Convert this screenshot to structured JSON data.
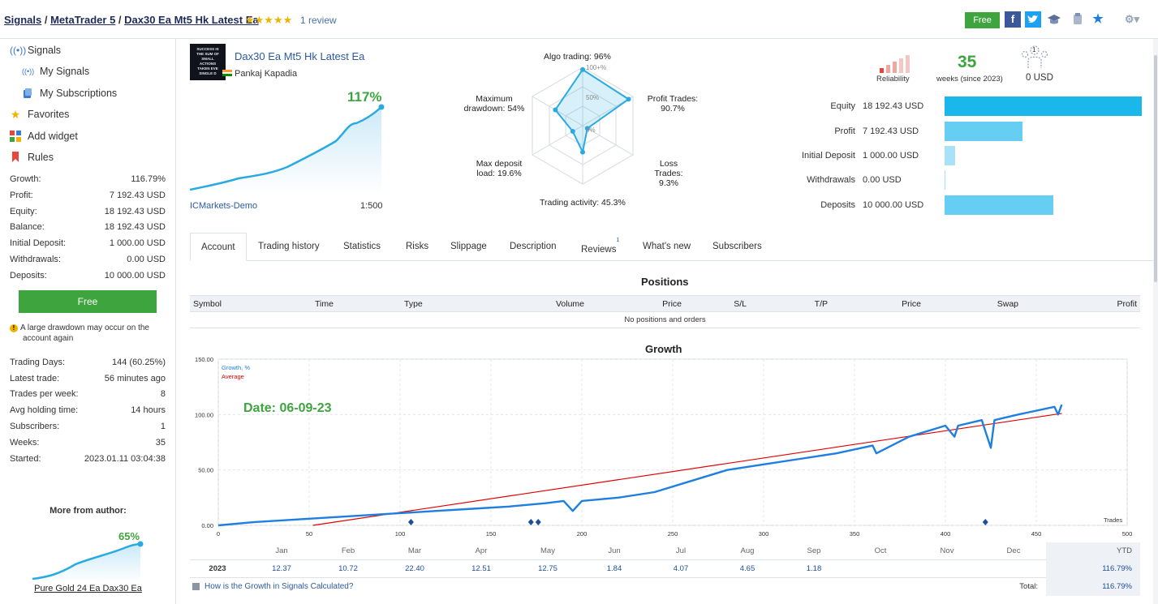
{
  "header": {
    "breadcrumb": [
      "Signals",
      "MetaTrader 5",
      "Dax30 Ea Mt5 Hk Latest Ea"
    ],
    "separator": " / ",
    "stars": "★★★★★",
    "review_text": "1 review",
    "free_button": "Free",
    "icons": [
      "facebook-icon",
      "twitter-icon",
      "graduation-cap-icon",
      "clipboard-icon",
      "star-icon",
      "gear-icon"
    ]
  },
  "sidebar": {
    "nav": [
      {
        "label": "Signals",
        "icon": "antenna-icon"
      },
      {
        "label": "My Signals",
        "icon": "antenna-icon"
      },
      {
        "label": "My Subscriptions",
        "icon": "subscriptions-icon"
      },
      {
        "label": "Favorites",
        "icon": "star-icon"
      },
      {
        "label": "Add widget",
        "icon": "widget-icon"
      },
      {
        "label": "Rules",
        "icon": "bookmark-icon"
      }
    ],
    "stats": [
      {
        "label": "Growth:",
        "value": "116.79%"
      },
      {
        "label": "Profit:",
        "value": "7 192.43 USD"
      },
      {
        "label": "Equity:",
        "value": "18 192.43 USD"
      },
      {
        "label": "Balance:",
        "value": "18 192.43 USD"
      },
      {
        "label": "Initial Deposit:",
        "value": "1 000.00 USD"
      },
      {
        "label": "Withdrawals:",
        "value": "0.00 USD"
      },
      {
        "label": "Deposits:",
        "value": "10 000.00 USD"
      }
    ],
    "free_button": "Free",
    "warning_line1": "A large drawdown may occur on the",
    "warning_line2": "account again",
    "stats2": [
      {
        "label": "Trading Days:",
        "value": "144 (60.25%)"
      },
      {
        "label": "Latest trade:",
        "value": "56 minutes ago"
      },
      {
        "label": "Trades per week:",
        "value": "8"
      },
      {
        "label": "Avg holding time:",
        "value": "14 hours"
      },
      {
        "label": "Subscribers:",
        "value": "1"
      },
      {
        "label": "Weeks:",
        "value": "35"
      },
      {
        "label": "Started:",
        "value": "2023.01.11 03:04:38"
      }
    ],
    "more_from_author": "More from author:",
    "author_growth": "65%",
    "author_signal": "Pure Gold 24 Ea Dax30 Ea"
  },
  "signal": {
    "name": "Dax30 Ea Mt5 Hk Latest Ea",
    "author": "Pankaj Kapadia",
    "growth": "117%",
    "broker": "ICMarkets-Demo",
    "leverage": "1:500",
    "thumb_lines": [
      "SUCCESS IS",
      "THE SUM OF",
      "SMALL",
      "ACTIONS",
      "TAKEN EVE",
      "SINGLE D"
    ]
  },
  "radar": {
    "labels": {
      "algo": "Algo trading: 96%",
      "profit_trades_1": "Profit Trades:",
      "profit_trades_2": "90.7%",
      "loss_trades_1": "Loss Trades:",
      "loss_trades_2": "9.3%",
      "activity": "Trading activity: 45.3%",
      "max_deposit_1": "Max deposit",
      "max_deposit_2": "load: 19.6%",
      "drawdown_1": "Maximum",
      "drawdown_2": "drawdown: 54%",
      "ring100": "100+%",
      "ring50": "50%",
      "ring0": "0%"
    },
    "values": {
      "algo": 96,
      "profit": 90.7,
      "loss": 9.3,
      "activity": 45.3,
      "deposit": 19.6,
      "drawdown": 54
    }
  },
  "summary": {
    "reliability_label": "Reliability",
    "weeks_value": "35",
    "weeks_label": "weeks (since 2023)",
    "subscribers_value": "1",
    "subscribers_funds": "0 USD",
    "bars": [
      {
        "label": "Equity",
        "value": "18 192.43 USD",
        "amount": 18192.43,
        "color": "#1ab7ea"
      },
      {
        "label": "Profit",
        "value": "7 192.43 USD",
        "amount": 7192.43,
        "color": "#66cdf3"
      },
      {
        "label": "Initial Deposit",
        "value": "1 000.00 USD",
        "amount": 1000,
        "color": "#a9e2f7"
      },
      {
        "label": "Withdrawals",
        "value": "0.00 USD",
        "amount": 0,
        "color": "#a9e2f7"
      },
      {
        "label": "Deposits",
        "value": "10 000.00 USD",
        "amount": 10000,
        "color": "#66cdf3"
      }
    ]
  },
  "tabs": [
    {
      "label": "Account",
      "active": true
    },
    {
      "label": "Trading history"
    },
    {
      "label": "Statistics"
    },
    {
      "label": "Risks"
    },
    {
      "label": "Slippage"
    },
    {
      "label": "Description"
    },
    {
      "label": "Reviews",
      "badge": "1"
    },
    {
      "label": "What's new"
    },
    {
      "label": "Subscribers"
    }
  ],
  "positions": {
    "title": "Positions",
    "columns": [
      "Symbol",
      "Time",
      "Type",
      "Volume",
      "Price",
      "S/L",
      "T/P",
      "Price",
      "Swap",
      "Profit"
    ],
    "empty": "No positions and orders"
  },
  "growth": {
    "title": "Growth",
    "legend_growth": "Growth, %",
    "legend_average": "Average",
    "date_overlay": "Date: 06-09-23",
    "trades_label": "Trades",
    "help_link": "How is the Growth in Signals Calculated?",
    "months": [
      "Jan",
      "Feb",
      "Mar",
      "Apr",
      "May",
      "Jun",
      "Jul",
      "Aug",
      "Sep",
      "Oct",
      "Nov",
      "Dec"
    ],
    "ytd_header": "YTD",
    "year": "2023",
    "year_values": [
      "12.37",
      "10.72",
      "22.40",
      "12.51",
      "12.75",
      "1.84",
      "4.07",
      "4.65",
      "1.18",
      "",
      "",
      ""
    ],
    "ytd": "116.79%",
    "total_label": "Total:",
    "total": "116.79%"
  },
  "chart_data": {
    "type": "line",
    "xlabel": "Trades",
    "ylabel": "",
    "xlim": [
      0,
      500
    ],
    "ylim": [
      0,
      150
    ],
    "x_ticks": [
      "0",
      "50",
      "100",
      "150",
      "200",
      "250",
      "300",
      "350",
      "400",
      "450",
      "500"
    ],
    "y_ticks": [
      "0.00",
      "50.00",
      "100.00",
      "150.00"
    ],
    "series": [
      {
        "name": "Growth, %",
        "color": "#1e7fe0",
        "x": [
          0,
          20,
          40,
          60,
          80,
          100,
          120,
          140,
          160,
          180,
          190,
          195,
          200,
          220,
          240,
          260,
          280,
          300,
          320,
          340,
          360,
          362,
          380,
          400,
          405,
          407,
          420,
          425,
          427,
          440,
          460,
          462,
          464
        ],
        "y": [
          0,
          3,
          5,
          7,
          9,
          11,
          13,
          15,
          17,
          20,
          22,
          13,
          22,
          25,
          30,
          40,
          50,
          55,
          60,
          65,
          72,
          65,
          80,
          90,
          80,
          90,
          95,
          70,
          95,
          100,
          107,
          100,
          109
        ]
      },
      {
        "name": "Average",
        "color": "#e00000",
        "x": [
          52,
          464
        ],
        "y": [
          0,
          101
        ]
      }
    ],
    "markers_x": [
      106,
      172,
      176,
      422
    ]
  }
}
